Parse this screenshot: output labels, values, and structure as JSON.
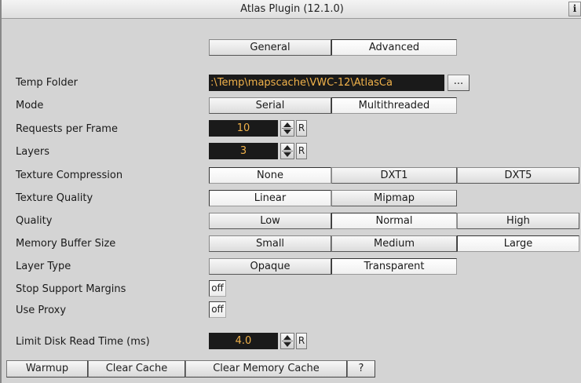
{
  "title": "Atlas Plugin (12.1.0)",
  "info_label": "i",
  "tabs": {
    "general": "General",
    "advanced": "Advanced"
  },
  "labels": {
    "temp_folder": "Temp Folder",
    "mode": "Mode",
    "requests_per_frame": "Requests per Frame",
    "layers": "Layers",
    "texture_compression": "Texture Compression",
    "texture_quality": "Texture Quality",
    "quality": "Quality",
    "memory_buffer_size": "Memory Buffer Size",
    "layer_type": "Layer Type",
    "stop_support_margins": "Stop Support Margins",
    "use_proxy": "Use Proxy",
    "limit_disk_read_time": "Limit Disk Read Time (ms)"
  },
  "temp_folder": {
    "value": ":\\Temp\\mapscache\\VWC-12\\AtlasCa",
    "browse_label": "..."
  },
  "mode": {
    "options": [
      "Serial",
      "Multithreaded"
    ]
  },
  "requests_per_frame": {
    "value": "10",
    "reset_label": "R"
  },
  "layers": {
    "value": "3",
    "reset_label": "R"
  },
  "texture_compression": {
    "options": [
      "None",
      "DXT1",
      "DXT5"
    ]
  },
  "texture_quality": {
    "options": [
      "Linear",
      "Mipmap"
    ]
  },
  "quality": {
    "options": [
      "Low",
      "Normal",
      "High"
    ]
  },
  "memory_buffer_size": {
    "options": [
      "Small",
      "Medium",
      "Large"
    ]
  },
  "layer_type": {
    "options": [
      "Opaque",
      "Transparent"
    ]
  },
  "stop_support_margins": {
    "value": "off"
  },
  "use_proxy": {
    "value": "off"
  },
  "limit_disk_read_time": {
    "value": "4.0",
    "reset_label": "R"
  },
  "bottom_buttons": {
    "warmup": "Warmup",
    "clear_cache": "Clear Cache",
    "clear_memory_cache": "Clear Memory Cache",
    "help": "?"
  },
  "colors": {
    "field_bg": "#1a1a1a",
    "field_text": "#f1b24a",
    "panel_bg": "#d4d4d4"
  }
}
